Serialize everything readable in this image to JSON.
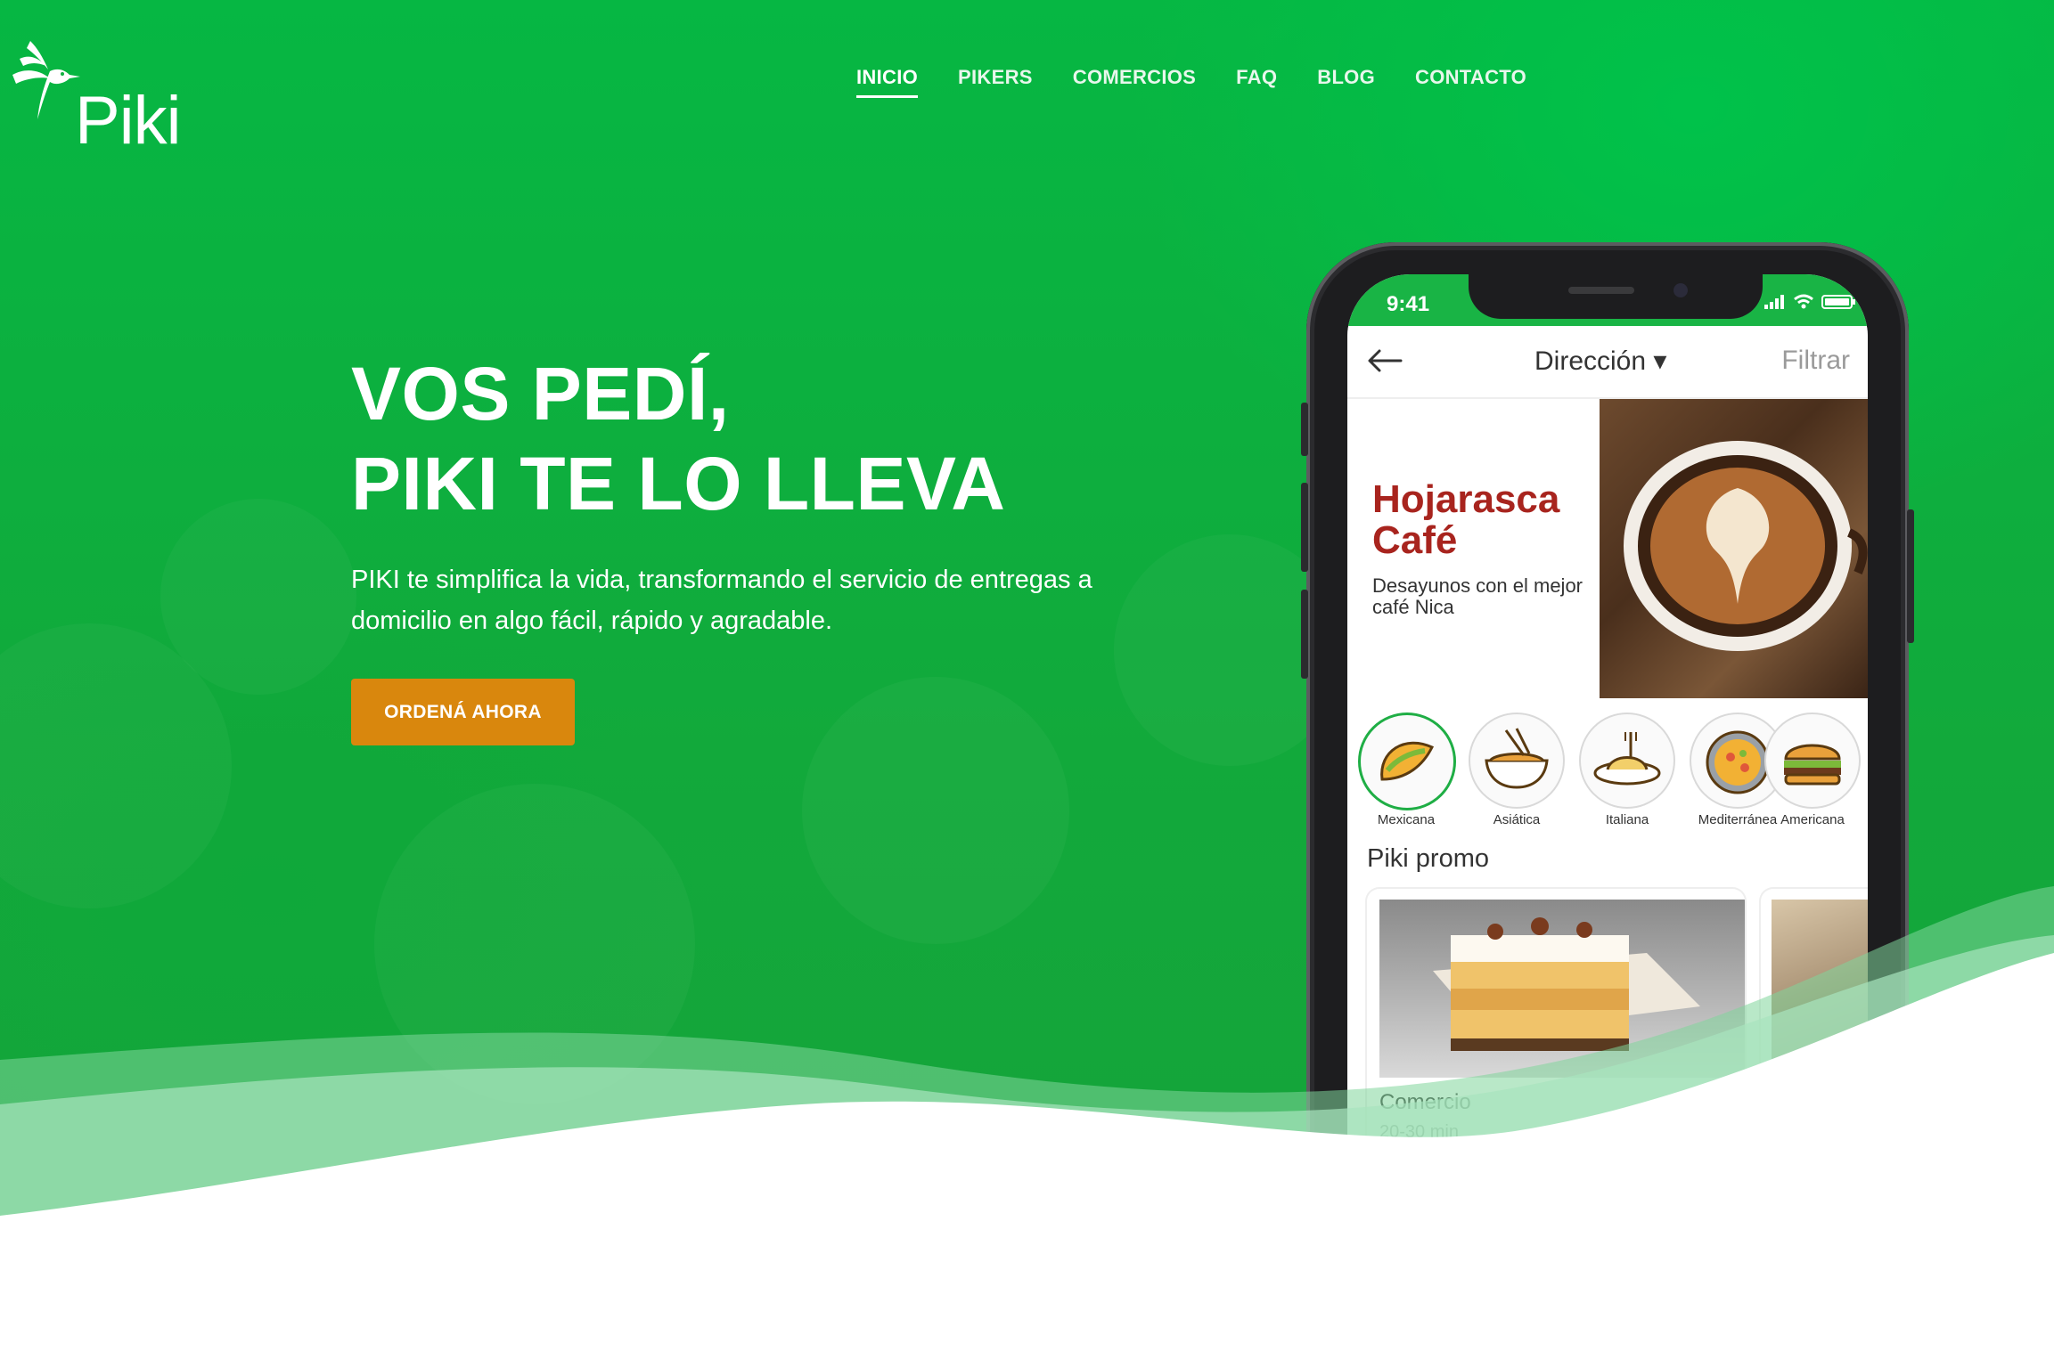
{
  "brand": {
    "name": "Piki"
  },
  "nav": {
    "items": [
      {
        "label": "INICIO",
        "active": true
      },
      {
        "label": "PIKERS",
        "active": false
      },
      {
        "label": "COMERCIOS",
        "active": false
      },
      {
        "label": "FAQ",
        "active": false
      },
      {
        "label": "BLOG",
        "active": false
      },
      {
        "label": "CONTACTO",
        "active": false
      }
    ]
  },
  "hero": {
    "headline_line1": "VOS PEDÍ,",
    "headline_line2": "PIKI TE LO LLEVA",
    "subtitle": "PIKI te simplifica la vida, transformando el servicio de entregas a domicilio en algo fácil, rápido y agradable.",
    "cta_label": "ORDENÁ AHORA"
  },
  "phone": {
    "time": "9:41",
    "appbar": {
      "title": "Dirección ▾",
      "filter": "Filtrar"
    },
    "banner": {
      "title_line1": "Hojarasca",
      "title_line2": "Café",
      "description": "Desayunos con el mejor café Nica"
    },
    "categories": [
      {
        "label": "Mexicana",
        "icon": "taco-icon"
      },
      {
        "label": "Asiática",
        "icon": "noodles-icon"
      },
      {
        "label": "Italiana",
        "icon": "spaghetti-icon"
      },
      {
        "label": "Mediterránea",
        "icon": "paella-icon"
      },
      {
        "label": "Americana",
        "icon": "burger-icon"
      }
    ],
    "promo_title": "Piki promo",
    "promo_card": {
      "label": "Comercio",
      "meta": "20-30 min"
    }
  },
  "colors": {
    "brand_green": "#12b040",
    "cta_orange": "#d9870d",
    "banner_red": "#a8241e"
  }
}
